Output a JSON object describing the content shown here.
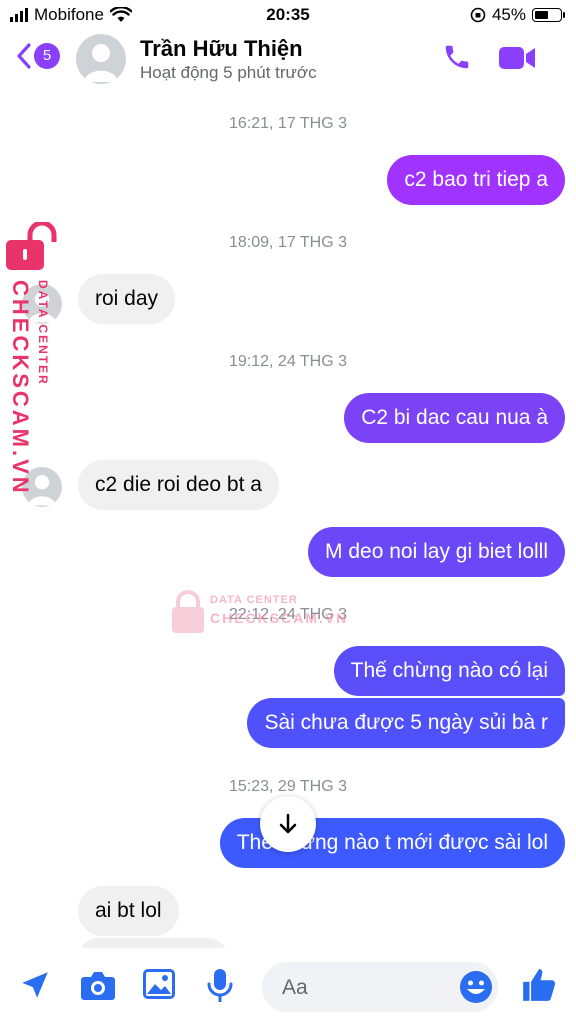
{
  "status_bar": {
    "carrier": "Mobifone",
    "time": "20:35",
    "battery": "45%"
  },
  "header": {
    "back_badge": "5",
    "contact_name": "Trần Hữu Thiện",
    "contact_status": "Hoạt động 5 phút trước"
  },
  "messages": [
    {
      "type": "timestamp",
      "text": "16:21, 17 THG 3"
    },
    {
      "type": "sent",
      "text": "c2 bao tri tiep a"
    },
    {
      "type": "timestamp",
      "text": "18:09, 17 THG 3"
    },
    {
      "type": "received",
      "text": "roi day"
    },
    {
      "type": "timestamp",
      "text": "19:12, 24 THG 3"
    },
    {
      "type": "sent",
      "text": "C2 bi dac cau nua à"
    },
    {
      "type": "received",
      "text": "c2 die roi deo bt a"
    },
    {
      "type": "sent",
      "text": "M deo noi lay gi biet lolll"
    },
    {
      "type": "timestamp",
      "text": "22:12, 24 THG 3"
    },
    {
      "type": "sent",
      "text": "Thế chừng nào có lại"
    },
    {
      "type": "sent",
      "text": "Sài chưa được 5 ngày sủi bà r"
    },
    {
      "type": "timestamp",
      "text": "15:23, 29 THG 3"
    },
    {
      "type": "sent",
      "text": "Thế chừng nào t mới được sài lol"
    },
    {
      "type": "received",
      "text": "ai bt lol"
    }
  ],
  "watermark": {
    "label_top": "DATA CENTER",
    "label_brand": "CHECKSCAM.VN"
  },
  "composer": {
    "placeholder": "Aa"
  },
  "colors": {
    "accent": "#8a3ffc",
    "bubble_top": "#a033ff",
    "bubble_bottom": "#3d5afe",
    "watermark": "#e8336b"
  }
}
